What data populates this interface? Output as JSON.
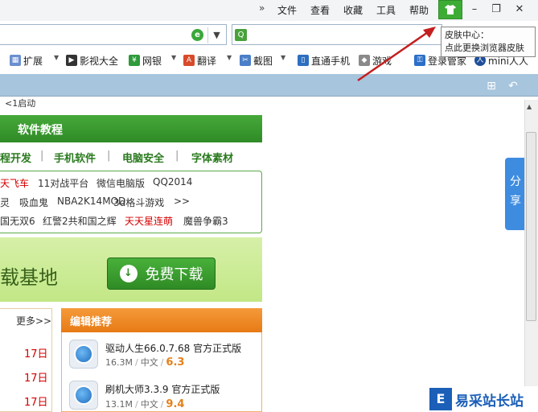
{
  "menu": {
    "chevron": "»",
    "items": [
      "文件",
      "查看",
      "收藏",
      "工具",
      "帮助"
    ]
  },
  "window_controls": {
    "minimize": "–",
    "restore": "❐",
    "close": "✕"
  },
  "bookmarks": [
    {
      "label": "扩展",
      "icon": "apps-icon"
    },
    {
      "label": "影视大全",
      "icon": "video-icon"
    },
    {
      "label": "网银",
      "icon": "bank-shield-icon"
    },
    {
      "label": "翻译",
      "icon": "translate-icon"
    },
    {
      "label": "截图",
      "icon": "scissors-icon"
    },
    {
      "label": "直通手机",
      "icon": "phone-icon"
    },
    {
      "label": "游戏",
      "icon": "gamepad-icon"
    },
    {
      "label": "登录管家",
      "icon": "key-icon"
    },
    {
      "label": "mini人人",
      "icon": "renren-icon"
    }
  ],
  "tooltip": {
    "line1": "皮肤中心：",
    "line2": "点此更换浏览器皮肤"
  },
  "page": {
    "fragment": "<1启动",
    "software": {
      "title": "软件教程",
      "nav": [
        "程开发",
        "手机软件",
        "电脑安全",
        "字体素材"
      ],
      "rows": [
        [
          "天飞车",
          "11对战平台",
          "微信电脑版",
          "QQ2014"
        ],
        [
          "灵",
          "吸血鬼",
          "NBA2K14MOD",
          "3d格斗游戏",
          ">>"
        ],
        [
          "国无双6",
          "红警2共和国之辉",
          "天天星连萌",
          "魔兽争霸3"
        ]
      ]
    },
    "banner": {
      "text": "载基地",
      "button": "免费下载"
    },
    "list": {
      "more": "更多>>",
      "dates": [
        "17日",
        "17日",
        "17日"
      ]
    },
    "editor": {
      "title": "编辑推荐",
      "apps": [
        {
          "name": "驱动人生66.0.7.68 官方正式版",
          "size": "16.3M",
          "lang": "中文",
          "score": "6.3"
        },
        {
          "name": "刷机大师3.3.9 官方正式版",
          "size": "13.1M",
          "lang": "中文",
          "score": "9.4"
        }
      ]
    },
    "share": [
      "分",
      "享"
    ],
    "watermark": {
      "logo": "E",
      "text": "易采站长站"
    }
  },
  "colors": {
    "accent_green": "#3dac35",
    "tab_strip": "#a7c5dd",
    "orange": "#e77a15",
    "red_text": "#d40000"
  }
}
